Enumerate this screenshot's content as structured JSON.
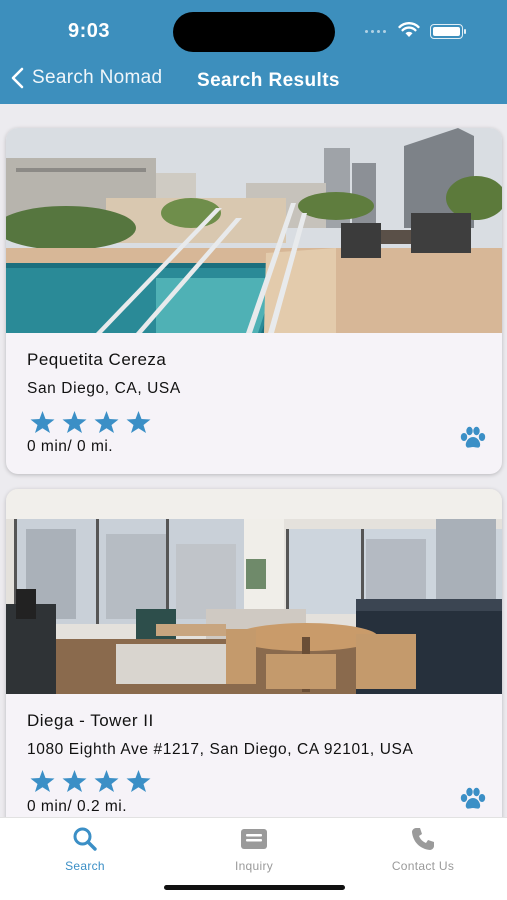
{
  "status_bar": {
    "time": "9:03"
  },
  "nav": {
    "back_label": "Search Nomad",
    "title": "Search Results"
  },
  "listings": [
    {
      "name": "Pequetita Cereza",
      "address": "San Diego, CA, USA",
      "rating": 4,
      "distance": "0 min/ 0 mi.",
      "pet_friendly": true,
      "photo": "rooftop-pool-photo"
    },
    {
      "name": "Diega - Tower II",
      "address": "1080 Eighth Ave #1217, San Diego, CA 92101, USA",
      "rating": 4,
      "distance": "0 min/ 0.2 mi.",
      "pet_friendly": true,
      "photo": "living-room-photo"
    }
  ],
  "tabs": [
    {
      "label": "Search",
      "icon": "search-icon",
      "active": true
    },
    {
      "label": "Inquiry",
      "icon": "inquiry-icon",
      "active": false
    },
    {
      "label": "Contact Us",
      "icon": "phone-icon",
      "active": false
    }
  ],
  "colors": {
    "header": "#3d8fbd",
    "accent": "#3b8fc6",
    "tab_inactive": "#9a9a9a"
  }
}
